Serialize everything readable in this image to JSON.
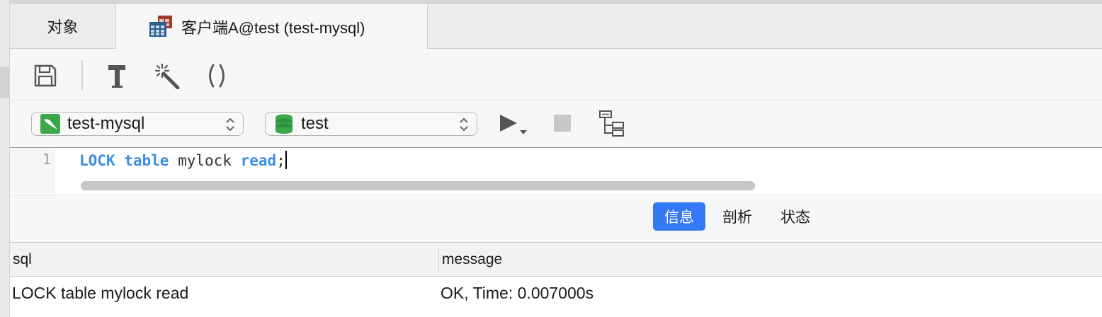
{
  "tabs": {
    "objects": "对象",
    "client": "客户端A@test (test-mysql)"
  },
  "connection": {
    "server": "test-mysql",
    "database": "test"
  },
  "editor": {
    "line_number": "1",
    "tokens": [
      {
        "text": "LOCK",
        "kw": true
      },
      {
        "text": " ",
        "kw": false
      },
      {
        "text": "table",
        "kw": true
      },
      {
        "text": " mylock ",
        "kw": false
      },
      {
        "text": "read",
        "kw": true
      },
      {
        "text": ";",
        "kw": false
      }
    ]
  },
  "result_tabs": {
    "info": "信息",
    "profile": "剖析",
    "status": "状态"
  },
  "grid": {
    "columns": [
      "sql",
      "message"
    ],
    "rows": [
      [
        "LOCK table mylock read",
        "OK, Time: 0.007000s"
      ]
    ]
  },
  "colors": {
    "accent": "#3478f6",
    "keyword": "#3d8fe0",
    "db_green": "#3aa84a"
  }
}
